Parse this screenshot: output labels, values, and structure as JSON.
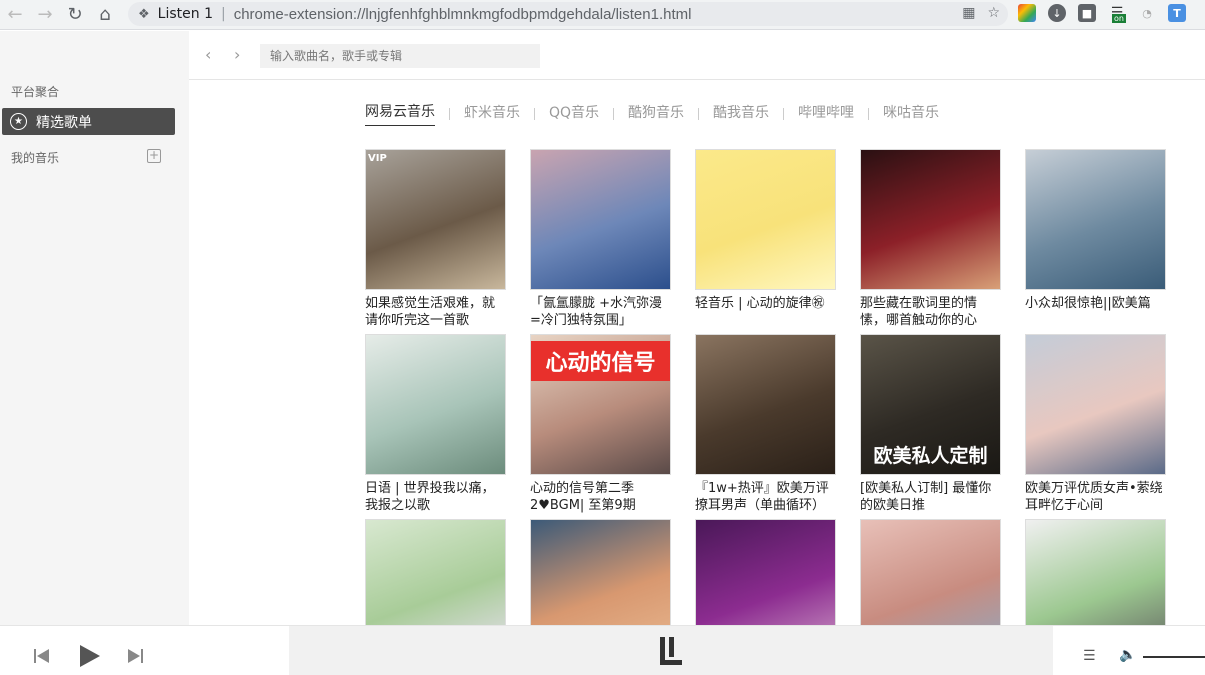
{
  "browser": {
    "tab_title": "Listen 1",
    "url": "chrome-extension://lnjgfenhfghblmnkmgfodbpmdgehdala/listen1.html",
    "ext_badge": "on"
  },
  "sidebar": {
    "section_platform": "平台聚合",
    "active_item": "精选歌单",
    "section_my_music": "我的音乐",
    "add_symbol": "+"
  },
  "header": {
    "search_placeholder": "输入歌曲名，歌手或专辑"
  },
  "tabs": [
    {
      "label": "网易云音乐",
      "active": true
    },
    {
      "label": "虾米音乐",
      "active": false
    },
    {
      "label": "QQ音乐",
      "active": false
    },
    {
      "label": "酷狗音乐",
      "active": false
    },
    {
      "label": "酷我音乐",
      "active": false
    },
    {
      "label": "哔哩哔哩",
      "active": false
    },
    {
      "label": "咪咕音乐",
      "active": false
    }
  ],
  "playlists": [
    {
      "title": "如果感觉生活艰难，就请你听完这一首歌",
      "badge": "VIP",
      "cover_text": "",
      "colors": [
        "#a8a29a",
        "#6b5a48",
        "#c8b79c"
      ]
    },
    {
      "title": "「氤氲朦胧 +水汽弥漫=冷门独特氛围」",
      "badge": "",
      "cover_text": "",
      "colors": [
        "#c9a4b0",
        "#6d87b8",
        "#2c4f8c"
      ]
    },
    {
      "title": "轻音乐 | 心动的旋律㊗",
      "badge": "",
      "cover_text": "",
      "colors": [
        "#fbe98a",
        "#f8e27a",
        "#fff7c0"
      ]
    },
    {
      "title": "那些藏在歌词里的情愫，哪首触动你的心",
      "badge": "",
      "cover_text": "",
      "colors": [
        "#2a1012",
        "#8c2028",
        "#d8a078"
      ]
    },
    {
      "title": "小众却很惊艳||欧美篇",
      "badge": "",
      "cover_text": "",
      "colors": [
        "#c6ced6",
        "#6e8aa0",
        "#3a5c78"
      ]
    },
    {
      "title": "日语 | 世界投我以痛，我报之以歌",
      "badge": "",
      "cover_text": "",
      "colors": [
        "#e6ece8",
        "#a8c4b8",
        "#6c8c7c"
      ]
    },
    {
      "title": "心动的信号第二季 2♥BGM| 至第9期",
      "badge": "",
      "cover_text": "心动的信号",
      "colors": [
        "#e8d4c4",
        "#b88c7c",
        "#5a4a48"
      ]
    },
    {
      "title": "『1w+热评』欧美万评撩耳男声（单曲循环）",
      "badge": "",
      "cover_text": "",
      "colors": [
        "#8a7460",
        "#4a3a2c",
        "#2a2018"
      ]
    },
    {
      "title": "[欧美私人订制] 最懂你的欧美日推",
      "badge": "",
      "cover_text": "欧美私人定制",
      "colors": [
        "#5a5448",
        "#2e2a24",
        "#1a1814"
      ]
    },
    {
      "title": "欧美万评优质女声•萦绕耳畔忆于心间",
      "badge": "",
      "cover_text": "",
      "colors": [
        "#c4ccd8",
        "#e8c8c0",
        "#5a6a88"
      ]
    },
    {
      "title": "",
      "badge": "",
      "cover_text": "",
      "colors": [
        "#d8e8d0",
        "#a8cc98",
        "#e8e0f0"
      ]
    },
    {
      "title": "",
      "badge": "",
      "cover_text": "",
      "colors": [
        "#3c5a78",
        "#d89870",
        "#e8b890"
      ]
    },
    {
      "title": "",
      "badge": "",
      "cover_text": "",
      "colors": [
        "#4a1858",
        "#8c2c90",
        "#d0a0c8"
      ]
    },
    {
      "title": "",
      "badge": "",
      "cover_text": "",
      "colors": [
        "#e8c0b8",
        "#c88c80",
        "#90a8c0"
      ]
    },
    {
      "title": "",
      "badge": "",
      "cover_text": "",
      "colors": [
        "#f0f0f0",
        "#9cc890",
        "#606060"
      ]
    }
  ],
  "colors": {
    "sidebar_bg": "#f5f5f5",
    "active_bg": "#4d4d4d"
  }
}
